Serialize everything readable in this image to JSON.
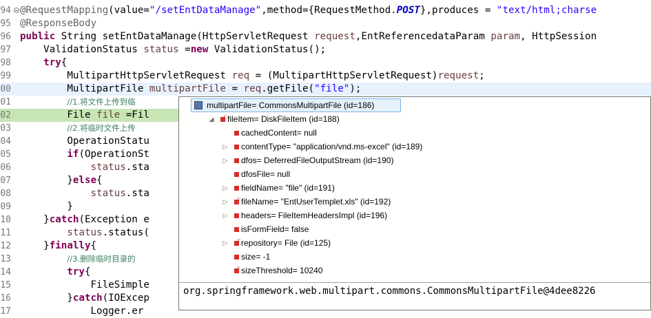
{
  "editor": {
    "lines": [
      {
        "num": "94",
        "marker": true,
        "tokens": [
          [
            "ann",
            "@RequestMapping"
          ],
          [
            "",
            "(value="
          ],
          [
            "str",
            "\"/setEntDataManage\""
          ],
          [
            "",
            ",method={RequestMethod."
          ],
          [
            "stat",
            "POST"
          ],
          [
            "",
            "},produces = "
          ],
          [
            "str",
            "\"text/html;charse"
          ]
        ]
      },
      {
        "num": "95",
        "tokens": [
          [
            "ann",
            "@ResponseBody"
          ]
        ]
      },
      {
        "num": "96",
        "tokens": [
          [
            "kw",
            "public"
          ],
          [
            "",
            " String setEntDataManage(HttpServletRequest "
          ],
          [
            "var",
            "request"
          ],
          [
            "",
            ",EntReferencedataParam "
          ],
          [
            "var",
            "param"
          ],
          [
            "",
            ", HttpSession"
          ]
        ]
      },
      {
        "num": "97",
        "tokens": [
          [
            "",
            "    ValidationStatus "
          ],
          [
            "var",
            "status"
          ],
          [
            "",
            " ="
          ],
          [
            "kw",
            "new"
          ],
          [
            "",
            " ValidationStatus();"
          ]
        ]
      },
      {
        "num": "98",
        "tokens": [
          [
            "",
            "    "
          ],
          [
            "kw",
            "try"
          ],
          [
            "",
            "{"
          ]
        ]
      },
      {
        "num": "99",
        "tokens": [
          [
            "",
            "        MultipartHttpServletRequest "
          ],
          [
            "var",
            "req"
          ],
          [
            "",
            " = (MultipartHttpServletRequest)"
          ],
          [
            "var",
            "request"
          ],
          [
            "",
            ";"
          ]
        ]
      },
      {
        "num": "00",
        "current": true,
        "tokens": [
          [
            "",
            "        MultipartFile "
          ],
          [
            "var",
            "multipartFile"
          ],
          [
            "",
            " = "
          ],
          [
            "var",
            "req"
          ],
          [
            "",
            ".getFile("
          ],
          [
            "str",
            "\"file\""
          ],
          [
            "",
            ");"
          ]
        ]
      },
      {
        "num": "01",
        "tokens": [
          [
            "",
            "        "
          ],
          [
            "cmt",
            "//1.将文件上传到临"
          ]
        ]
      },
      {
        "num": "02",
        "bp": true,
        "tokens": [
          [
            "",
            "        File "
          ],
          [
            "var",
            "file"
          ],
          [
            "",
            " =Fil"
          ]
        ]
      },
      {
        "num": "03",
        "tokens": [
          [
            "",
            "        "
          ],
          [
            "cmt",
            "//2.将临时文件上传"
          ]
        ]
      },
      {
        "num": "04",
        "tokens": [
          [
            "",
            "        OperationStatu"
          ]
        ]
      },
      {
        "num": "05",
        "tokens": [
          [
            "",
            "        "
          ],
          [
            "kw",
            "if"
          ],
          [
            "",
            "(OperationSt"
          ]
        ]
      },
      {
        "num": "06",
        "tokens": [
          [
            "",
            "            "
          ],
          [
            "var",
            "status"
          ],
          [
            "",
            ".sta"
          ]
        ]
      },
      {
        "num": "07",
        "tokens": [
          [
            "",
            "        }"
          ],
          [
            "kw",
            "else"
          ],
          [
            "",
            "{"
          ]
        ]
      },
      {
        "num": "08",
        "tokens": [
          [
            "",
            "            "
          ],
          [
            "var",
            "status"
          ],
          [
            "",
            ".sta"
          ]
        ]
      },
      {
        "num": "09",
        "tokens": [
          [
            "",
            "        }"
          ]
        ]
      },
      {
        "num": "10",
        "tokens": [
          [
            "",
            "    }"
          ],
          [
            "kw",
            "catch"
          ],
          [
            "",
            "(Exception e"
          ]
        ]
      },
      {
        "num": "11",
        "tokens": [
          [
            "",
            "        "
          ],
          [
            "var",
            "status"
          ],
          [
            "",
            ".status("
          ]
        ]
      },
      {
        "num": "12",
        "tokens": [
          [
            "",
            "    }"
          ],
          [
            "kw",
            "finally"
          ],
          [
            "",
            "{"
          ]
        ]
      },
      {
        "num": "13",
        "tokens": [
          [
            "",
            "        "
          ],
          [
            "cmt",
            "//3.删除临时目录的"
          ]
        ]
      },
      {
        "num": "14",
        "tokens": [
          [
            "",
            "        "
          ],
          [
            "kw",
            "try"
          ],
          [
            "",
            "{"
          ]
        ]
      },
      {
        "num": "15",
        "tokens": [
          [
            "",
            "            FileSimple"
          ]
        ]
      },
      {
        "num": "16",
        "tokens": [
          [
            "",
            "        }"
          ],
          [
            "kw",
            "catch"
          ],
          [
            "",
            "(IOExcep"
          ]
        ]
      },
      {
        "num": "17",
        "tokens": [
          [
            "",
            "            Logger.er"
          ]
        ]
      }
    ]
  },
  "debug_popup": {
    "nodes": [
      {
        "level": 0,
        "twisty": "▲",
        "icon": "root",
        "label": "multipartFile= CommonsMultipartFile  (id=186)",
        "selected": true
      },
      {
        "level": 1,
        "twisty": "◢",
        "icon": "fin",
        "label": "fileItem= DiskFileItem  (id=188)"
      },
      {
        "level": 2,
        "twisty": "",
        "icon": "field",
        "label": "cachedContent= null"
      },
      {
        "level": 2,
        "twisty": "▷",
        "icon": "field",
        "label": "contentType= \"application/vnd.ms-excel\" (id=189)"
      },
      {
        "level": 2,
        "twisty": "▷",
        "icon": "field",
        "label": "dfos= DeferredFileOutputStream  (id=190)"
      },
      {
        "level": 2,
        "twisty": "",
        "icon": "field",
        "label": "dfosFile= null"
      },
      {
        "level": 2,
        "twisty": "▷",
        "icon": "field",
        "label": "fieldName= \"file\" (id=191)"
      },
      {
        "level": 2,
        "twisty": "▷",
        "icon": "fin",
        "label": "fileName= \"EntUserTemplet.xls\" (id=192)"
      },
      {
        "level": 2,
        "twisty": "▷",
        "icon": "field",
        "label": "headers= FileItemHeadersImpl  (id=196)"
      },
      {
        "level": 2,
        "twisty": "",
        "icon": "field",
        "label": "isFormField= false"
      },
      {
        "level": 2,
        "twisty": "▷",
        "icon": "fin",
        "label": "repository= File  (id=125)"
      },
      {
        "level": 2,
        "twisty": "",
        "icon": "field",
        "label": "size= -1"
      },
      {
        "level": 2,
        "twisty": "",
        "icon": "fin",
        "label": "sizeThreshold= 10240"
      }
    ],
    "detail_text": "org.springframework.web.multipart.commons.CommonsMultipartFile@4dee8226"
  }
}
